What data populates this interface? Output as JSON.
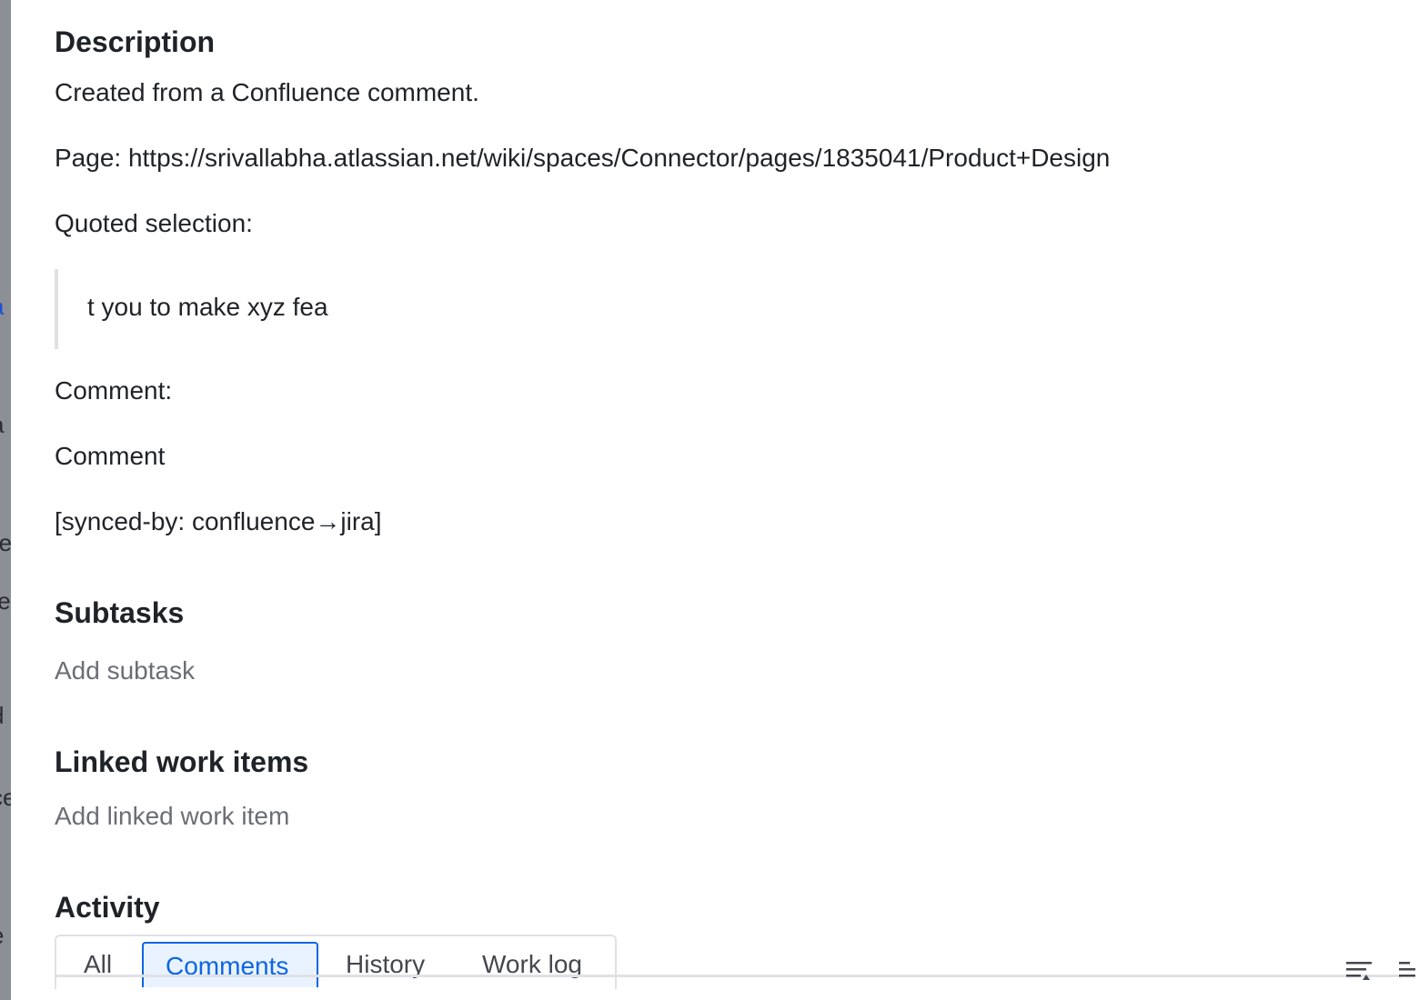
{
  "backdrop": {
    "fragments": [
      "a",
      "[",
      "a",
      "d",
      "re",
      "te",
      "d",
      "ce",
      "e"
    ]
  },
  "description": {
    "heading": "Description",
    "intro": "Created from a Confluence comment.",
    "page_line": "Page: https://srivallabha.atlassian.net/wiki/spaces/Connector/pages/1835041/Product+Design",
    "quoted_label": "Quoted selection:",
    "quote": "t you to make xyz fea",
    "comment_label": "Comment:",
    "comment_text": "Comment",
    "synced_by": "[synced-by: confluence→jira]"
  },
  "subtasks": {
    "heading": "Subtasks",
    "add_label": "Add subtask"
  },
  "linked": {
    "heading": "Linked work items",
    "add_label": "Add linked work item"
  },
  "activity": {
    "heading": "Activity",
    "tabs": [
      {
        "label": "All",
        "active": false
      },
      {
        "label": "Comments",
        "active": true
      },
      {
        "label": "History",
        "active": false
      },
      {
        "label": "Work log",
        "active": false
      }
    ],
    "icons": [
      "sort-icon",
      "sort-order-icon"
    ]
  },
  "colors": {
    "accent": "#0c66e4",
    "text": "#1f2328",
    "muted": "#6b6e76",
    "border": "#dfe1e6"
  }
}
